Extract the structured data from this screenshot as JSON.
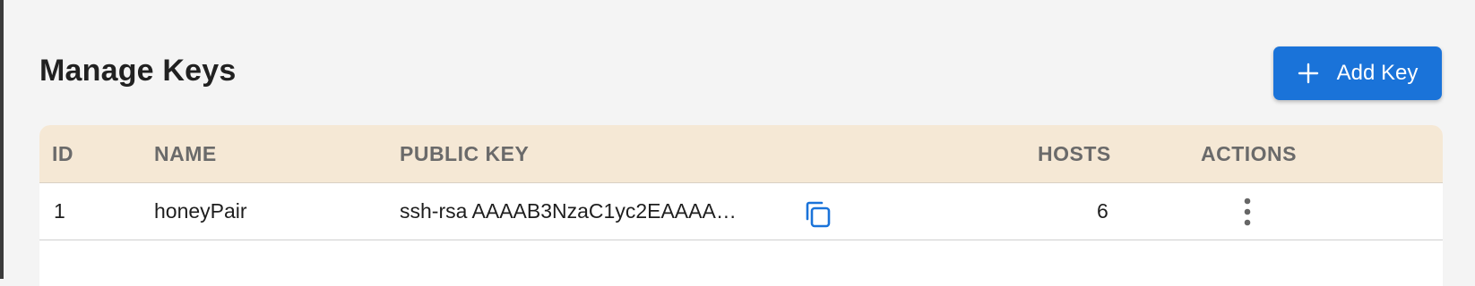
{
  "page": {
    "title": "Manage Keys",
    "add_button_label": "Add Key"
  },
  "table": {
    "columns": [
      "ID",
      "NAME",
      "PUBLIC KEY",
      "HOSTS",
      "ACTIONS"
    ],
    "rows": [
      {
        "id": "1",
        "name": "honeyPair",
        "public_key": "ssh-rsa AAAAB3NzaC1yc2EAAAA…",
        "hosts": "6"
      }
    ]
  },
  "icons": {
    "add": "plus-icon",
    "copy": "copy-icon",
    "actions": "more-vertical-icon"
  },
  "colors": {
    "accent": "#1a73d9",
    "header_bg": "#f5e8d5",
    "background": "#f4f4f4"
  }
}
